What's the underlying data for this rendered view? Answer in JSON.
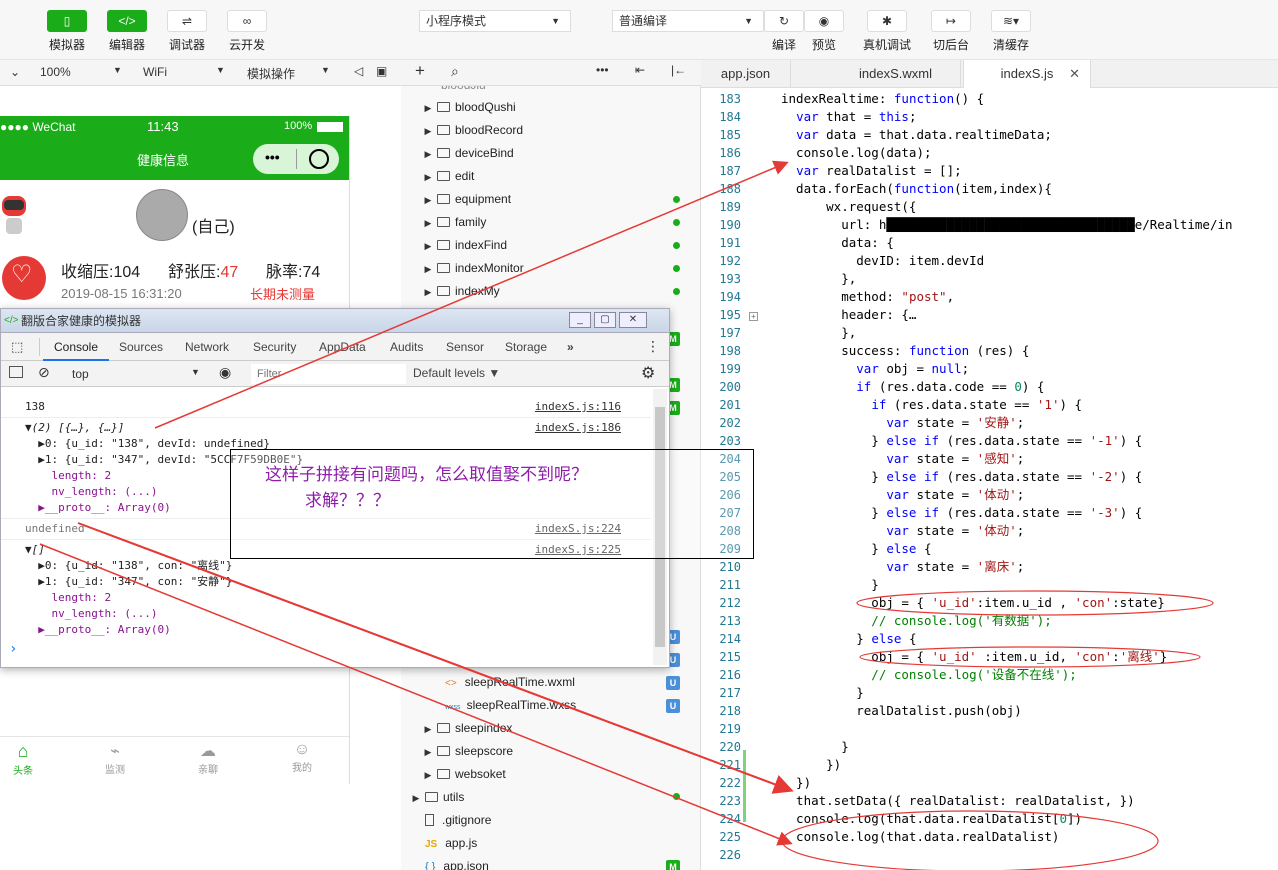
{
  "toolbar": {
    "buttons": [
      {
        "icon": "phone-icon",
        "label": "模拟器"
      },
      {
        "icon": "code-icon",
        "label": "编辑器"
      },
      {
        "icon": "sliders-icon",
        "label": "调试器"
      },
      {
        "icon": "cloud-link-icon",
        "label": "云开发"
      }
    ],
    "mode_select": "小程序模式",
    "compile_select": "普通编译",
    "right_buttons": [
      {
        "icon": "refresh-icon",
        "label": "编译"
      },
      {
        "icon": "eye-icon",
        "label": "预览"
      },
      {
        "icon": "bug-icon",
        "label": "真机调试"
      },
      {
        "icon": "switch-icon",
        "label": "切后台"
      },
      {
        "icon": "layers-icon",
        "label": "清缓存"
      }
    ]
  },
  "subbar": {
    "zoom": "100%",
    "network": "WiFi",
    "sim_action": "模拟操作"
  },
  "phone": {
    "carrier": "●●●● WeChat",
    "time": "11:43",
    "battery": "100%",
    "nav_title": "健康信息",
    "self_label": "(自己)",
    "systolic": "收缩压:104",
    "diastolic_label": "舒张压:",
    "diastolic_value": "47",
    "pulse": "脉率:74",
    "datetime": "2019-08-15 16:31:20",
    "warning": "长期未测量",
    "tabbar": [
      "头条",
      "监测",
      "亲聊",
      "我的"
    ]
  },
  "filetree": {
    "items": [
      {
        "name": "bloodQushi",
        "type": "folder"
      },
      {
        "name": "bloodRecord",
        "type": "folder"
      },
      {
        "name": "deviceBind",
        "type": "folder"
      },
      {
        "name": "edit",
        "type": "folder"
      },
      {
        "name": "equipment",
        "type": "folder"
      },
      {
        "name": "family",
        "type": "folder"
      },
      {
        "name": "indexFind",
        "type": "folder"
      },
      {
        "name": "indexMonitor",
        "type": "folder"
      },
      {
        "name": "indexMy",
        "type": "folder"
      }
    ],
    "lower_items": [
      {
        "name": "sleepRealTime.wxml",
        "badge": "U"
      },
      {
        "name": "sleepRealTime.wxss",
        "badge": "U"
      },
      {
        "name": "sleepindex",
        "type": "folder"
      },
      {
        "name": "sleepscore",
        "type": "folder"
      },
      {
        "name": "websoket",
        "type": "folder"
      },
      {
        "name": "utils",
        "type": "folder"
      },
      {
        "name": ".gitignore",
        "type": "file"
      },
      {
        "name": "app.js",
        "type": "file"
      },
      {
        "name": "app.json",
        "type": "file",
        "badge": "M"
      }
    ]
  },
  "editor_tabs": [
    "app.json",
    "indexS.wxml",
    "indexS.js"
  ],
  "code_lines": [
    {
      "n": "183",
      "t": "indexRealtime: function() {"
    },
    {
      "n": "184",
      "t": "  var that = this;"
    },
    {
      "n": "185",
      "t": "  var data = that.data.realtimeData;"
    },
    {
      "n": "186",
      "t": "  console.log(data);"
    },
    {
      "n": "187",
      "t": "  var realDatalist = [];"
    },
    {
      "n": "188",
      "t": "  data.forEach(function(item,index){"
    },
    {
      "n": "189",
      "t": "      wx.request({"
    },
    {
      "n": "190",
      "t": "        url: 'h█████████████████████████████████e/Realtime/in"
    },
    {
      "n": "191",
      "t": "        data: {"
    },
    {
      "n": "192",
      "t": "          devID: item.devId"
    },
    {
      "n": "193",
      "t": "        },"
    },
    {
      "n": "194",
      "t": "        method: \"post\","
    },
    {
      "n": "195",
      "t": "        header: {…"
    },
    {
      "n": "197",
      "t": "        },"
    },
    {
      "n": "198",
      "t": "        success: function (res) {"
    },
    {
      "n": "199",
      "t": "          var obj = null;"
    },
    {
      "n": "200",
      "t": "          if (res.data.code == 0) {"
    },
    {
      "n": "201",
      "t": "            if (res.data.state == '1') {"
    },
    {
      "n": "202",
      "t": "              var state = '安静';"
    },
    {
      "n": "203",
      "t": "            } else if (res.data.state == '-1') {"
    },
    {
      "n": "204",
      "t": "              var state = '感知';"
    },
    {
      "n": "205",
      "t": "            } else if (res.data.state == '-2') {"
    },
    {
      "n": "206",
      "t": "              var state = '体动';"
    },
    {
      "n": "207",
      "t": "            } else if (res.data.state == '-3') {"
    },
    {
      "n": "208",
      "t": "              var state = '体动';"
    },
    {
      "n": "209",
      "t": "            } else {"
    },
    {
      "n": "210",
      "t": "              var state = '离床';"
    },
    {
      "n": "211",
      "t": "            }"
    },
    {
      "n": "212",
      "t": "            obj = { 'u_id':item.u_id , 'con':state}"
    },
    {
      "n": "213",
      "t": "            // console.log('有数据');"
    },
    {
      "n": "214",
      "t": "          } else {"
    },
    {
      "n": "215",
      "t": "            obj = { 'u_id' :item.u_id, 'con':'离线'}"
    },
    {
      "n": "216",
      "t": "            // console.log('设备不在线');"
    },
    {
      "n": "217",
      "t": "          }"
    },
    {
      "n": "218",
      "t": "          realDatalist.push(obj)"
    },
    {
      "n": "219",
      "t": ""
    },
    {
      "n": "220",
      "t": "        }"
    },
    {
      "n": "221",
      "t": "      })"
    },
    {
      "n": "222",
      "t": "  })"
    },
    {
      "n": "223",
      "t": "  that.setData({ realDatalist: realDatalist, })"
    },
    {
      "n": "224",
      "t": "  console.log(that.data.realDatalist[0])"
    },
    {
      "n": "225",
      "t": "  console.log(that.data.realDatalist)"
    },
    {
      "n": "226",
      "t": ""
    }
  ],
  "devtools": {
    "title": "翻版合家健康的模拟器",
    "tabs": [
      "Console",
      "Sources",
      "Network",
      "Security",
      "AppData",
      "Audits",
      "Sensor",
      "Storage",
      "»"
    ],
    "context": "top",
    "filter_placeholder": "Filter",
    "levels": "Default levels ▼",
    "rows": [
      {
        "text": "138",
        "link": "indexS.js:116"
      },
      {
        "text": "▼(2) [{…}, {…}]",
        "link": "indexS.js:186"
      },
      {
        "text": "  ▶0: {u_id: \"138\", devId: undefined}",
        "link": ""
      },
      {
        "text": "  ▶1: {u_id: \"347\", devId: \"5CCF7F59DB0E\"}",
        "link": ""
      },
      {
        "text": "    length: 2",
        "link": ""
      },
      {
        "text": "    nv_length: (...)",
        "link": ""
      },
      {
        "text": "  ▶__proto__: Array(0)",
        "link": ""
      },
      {
        "text": "undefined",
        "link": "indexS.js:224"
      },
      {
        "text": "▼[]",
        "link": "indexS.js:225"
      },
      {
        "text": "  ▶0: {u_id: \"138\", con: \"离线\"}",
        "link": ""
      },
      {
        "text": "  ▶1: {u_id: \"347\", con: \"安静\"}",
        "link": ""
      },
      {
        "text": "    length: 2",
        "link": ""
      },
      {
        "text": "    nv_length: (...)",
        "link": ""
      },
      {
        "text": "  ▶__proto__: Array(0)",
        "link": ""
      }
    ],
    "prompt": "›"
  },
  "annotation": {
    "line1": "这样子拼接有问题吗，怎么取值娶不到呢？",
    "line2": "求解？？？"
  },
  "colors": {
    "brand": "#1aad19",
    "annot": "#e53935"
  }
}
